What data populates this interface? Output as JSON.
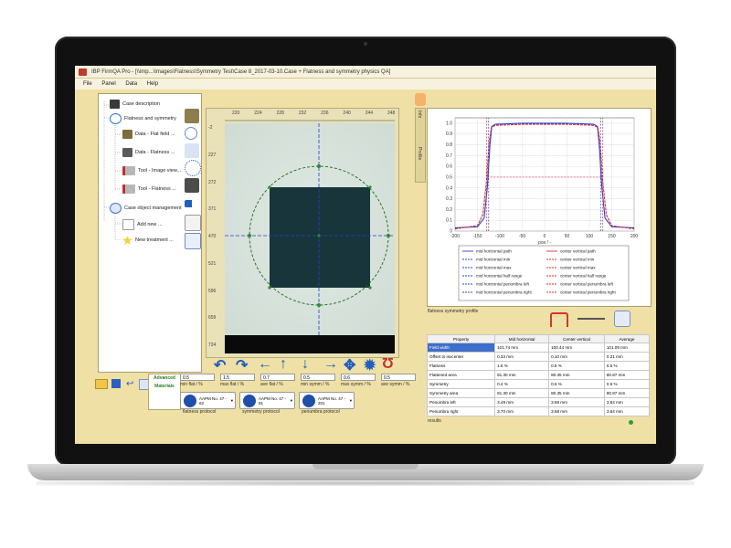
{
  "window": {
    "title": "IBP FirmQA Pro - [\\\\imp...\\Images\\Flatness\\Symmetry Test\\Case 8_2017-03-10.Case + Flatness and symmetry physics QA]",
    "menu": [
      "File",
      "Panel",
      "Data",
      "Help"
    ]
  },
  "tree": {
    "items": [
      {
        "label": "Case description",
        "icon": "case-icon"
      },
      {
        "label": "Flatness and symmetry",
        "icon": "flatness-icon"
      },
      {
        "label": "Data - Flat field ...",
        "icon": "image-data-icon"
      },
      {
        "label": "Data - Flatness ...",
        "icon": "image-data-icon"
      },
      {
        "label": "Tool - Image view...",
        "icon": "tool-icon"
      },
      {
        "label": "Tool - Flatness ...",
        "icon": "tool-icon"
      },
      {
        "label": "Case object management",
        "icon": "gear-icon"
      },
      {
        "label": "Add new ...",
        "icon": "add-icon"
      },
      {
        "label": "New treatment ...",
        "icon": "star-icon"
      }
    ]
  },
  "image_panel": {
    "ruler_top": [
      "220",
      "224",
      "228",
      "232",
      "236",
      "240",
      "244",
      "248"
    ],
    "ruler_left": [
      "-2",
      "227",
      "272",
      "371",
      "470",
      "521",
      "596",
      "659",
      "724"
    ]
  },
  "vtab_left": "Image",
  "fields": {
    "min_flat": {
      "value": "0.5",
      "label": "min flat / %"
    },
    "max_flat": {
      "value": "1.5",
      "label": "max flat / %"
    },
    "ave_flat": {
      "value": "0.7",
      "label": "ave flat / %"
    },
    "min_symm": {
      "value": "0.5",
      "label": "min symm / %"
    },
    "max_symm": {
      "value": "0.6",
      "label": "max symm / %"
    },
    "ave_symm": {
      "value": "0.5",
      "label": "ave symm / %"
    }
  },
  "protocols": [
    {
      "value": "AAPM No. 47 - 62",
      "label": "flatness protocol"
    },
    {
      "value": "AAPM No. 47 - 81",
      "label": "symmetry protocol"
    },
    {
      "value": "AAPM No. 47 - 201",
      "label": "penumbra protocol"
    }
  ],
  "logo_text": "Advanced Materials",
  "vtabs_right": [
    "Profile",
    "Info"
  ],
  "chart_data": {
    "type": "line",
    "title": "",
    "xlabel": "pos / -",
    "ylabel": "",
    "xlim": [
      -200,
      200
    ],
    "ylim": [
      0,
      1.05
    ],
    "x_ticks": [
      "-200",
      "-150",
      "-100",
      "-50",
      "0",
      "50",
      "100",
      "150",
      "200"
    ],
    "y_ticks": [
      "0",
      "0.1",
      "0.2",
      "0.3",
      "0.4",
      "0.5",
      "0.6",
      "0.7",
      "0.8",
      "0.9",
      "1.0"
    ],
    "series": [
      {
        "name": "mid horizontal path",
        "color": "#2f3fd6",
        "x": [
          -200,
          -150,
          -135,
          -128,
          -122,
          -118,
          -110,
          -50,
          0,
          50,
          110,
          118,
          122,
          128,
          135,
          150,
          200
        ],
        "values": [
          0.03,
          0.04,
          0.12,
          0.4,
          0.8,
          0.97,
          0.99,
          1.0,
          1.0,
          1.0,
          0.99,
          0.97,
          0.8,
          0.4,
          0.12,
          0.04,
          0.03
        ]
      },
      {
        "name": "center vertical path",
        "color": "#d32f2f",
        "x": [
          -200,
          -150,
          -138,
          -130,
          -124,
          -119,
          -110,
          -50,
          0,
          50,
          110,
          119,
          124,
          130,
          138,
          150,
          200
        ],
        "values": [
          0.02,
          0.05,
          0.15,
          0.45,
          0.82,
          0.96,
          0.98,
          0.99,
          0.99,
          0.99,
          0.98,
          0.96,
          0.82,
          0.45,
          0.15,
          0.05,
          0.02
        ]
      },
      {
        "name": "mid horizontal penumbra left",
        "color": "#2f3fd6",
        "x": [
          -125,
          -125
        ],
        "values": [
          0,
          1.05
        ]
      },
      {
        "name": "center vertical penumbra right",
        "color": "#d32f2f",
        "x": [
          -128,
          128
        ],
        "values": [
          0.5,
          0.5
        ]
      }
    ],
    "legend": [
      {
        "name": "mid horizontal path",
        "color": "#2f3fd6"
      },
      {
        "name": "mid horizontal min",
        "color": "#2f3fd6"
      },
      {
        "name": "mid horizontal max",
        "color": "#2f3fd6"
      },
      {
        "name": "mid horizontal half range",
        "color": "#2f3fd6"
      },
      {
        "name": "mid horizontal penumbra left",
        "color": "#2f3fd6"
      },
      {
        "name": "mid horizontal penumbra right",
        "color": "#2f3fd6"
      },
      {
        "name": "center vertical path",
        "color": "#d32f2f"
      },
      {
        "name": "center vertical min",
        "color": "#d32f2f"
      },
      {
        "name": "center vertical max",
        "color": "#d32f2f"
      },
      {
        "name": "center vertical half range",
        "color": "#d32f2f"
      },
      {
        "name": "center vertical penumbra left",
        "color": "#d32f2f"
      },
      {
        "name": "center vertical penumbra right",
        "color": "#d32f2f"
      }
    ],
    "grid": true,
    "legend_placement": "bottom"
  },
  "chart_caption": "flatness symmetry profile",
  "table": {
    "headers": [
      "Property",
      "Mid horizontal",
      "Center vertical",
      "Average"
    ],
    "rows": [
      [
        "Field width",
        "101.74 mm",
        "100.44 mm",
        "101.09 mm"
      ],
      [
        "Offset to isocenter",
        "0.33 mm",
        "0.10 mm",
        "0.21 mm"
      ],
      [
        "Flatness",
        "1.6 %",
        "0.5 %",
        "0.5 %"
      ],
      [
        "Flattened area",
        "81.30 mm",
        "80.35 mm",
        "80.87 mm"
      ],
      [
        "Symmetry",
        "0.4 %",
        "0.5 %",
        "0.5 %"
      ],
      [
        "Symmetry area",
        "81.30 mm",
        "80.35 mm",
        "80.87 mm"
      ],
      [
        "Penumbra left",
        "3.49 mm",
        "3.68 mm",
        "3.64 mm"
      ],
      [
        "Penumbra right",
        "3.70 mm",
        "3.68 mm",
        "3.64 mm"
      ]
    ]
  },
  "results_label": "results"
}
